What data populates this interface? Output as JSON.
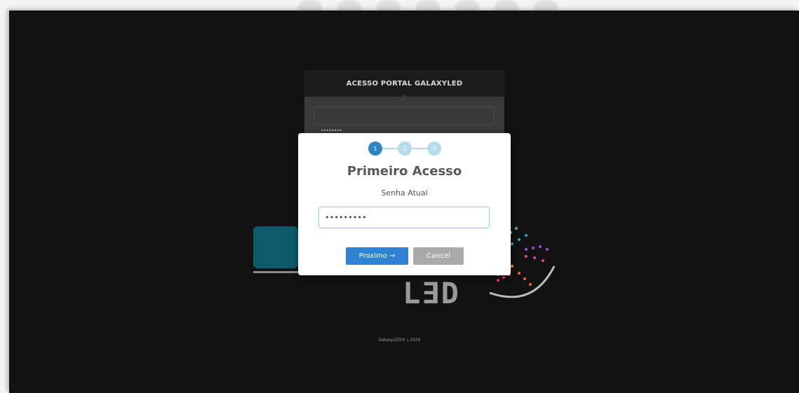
{
  "login_card": {
    "header": "ACESSO PORTAL GALAXYLED",
    "password_mask": "••••••••"
  },
  "background_logo": {
    "led_text": "L∃D"
  },
  "footer": {
    "text": "GalaxyLED® | 2020"
  },
  "modal": {
    "steps": [
      "1",
      "2",
      "3"
    ],
    "active_step": 1,
    "title": "Primeiro Acesso",
    "label": "Senha Atual",
    "password_value": "•••••••••",
    "next_label": "Proximo →",
    "cancel_label": "Cancel"
  },
  "colors": {
    "accent": "#2d85c8",
    "step_inactive": "#b4dcea",
    "cancel": "#aaaaaa",
    "background": "#121212"
  }
}
